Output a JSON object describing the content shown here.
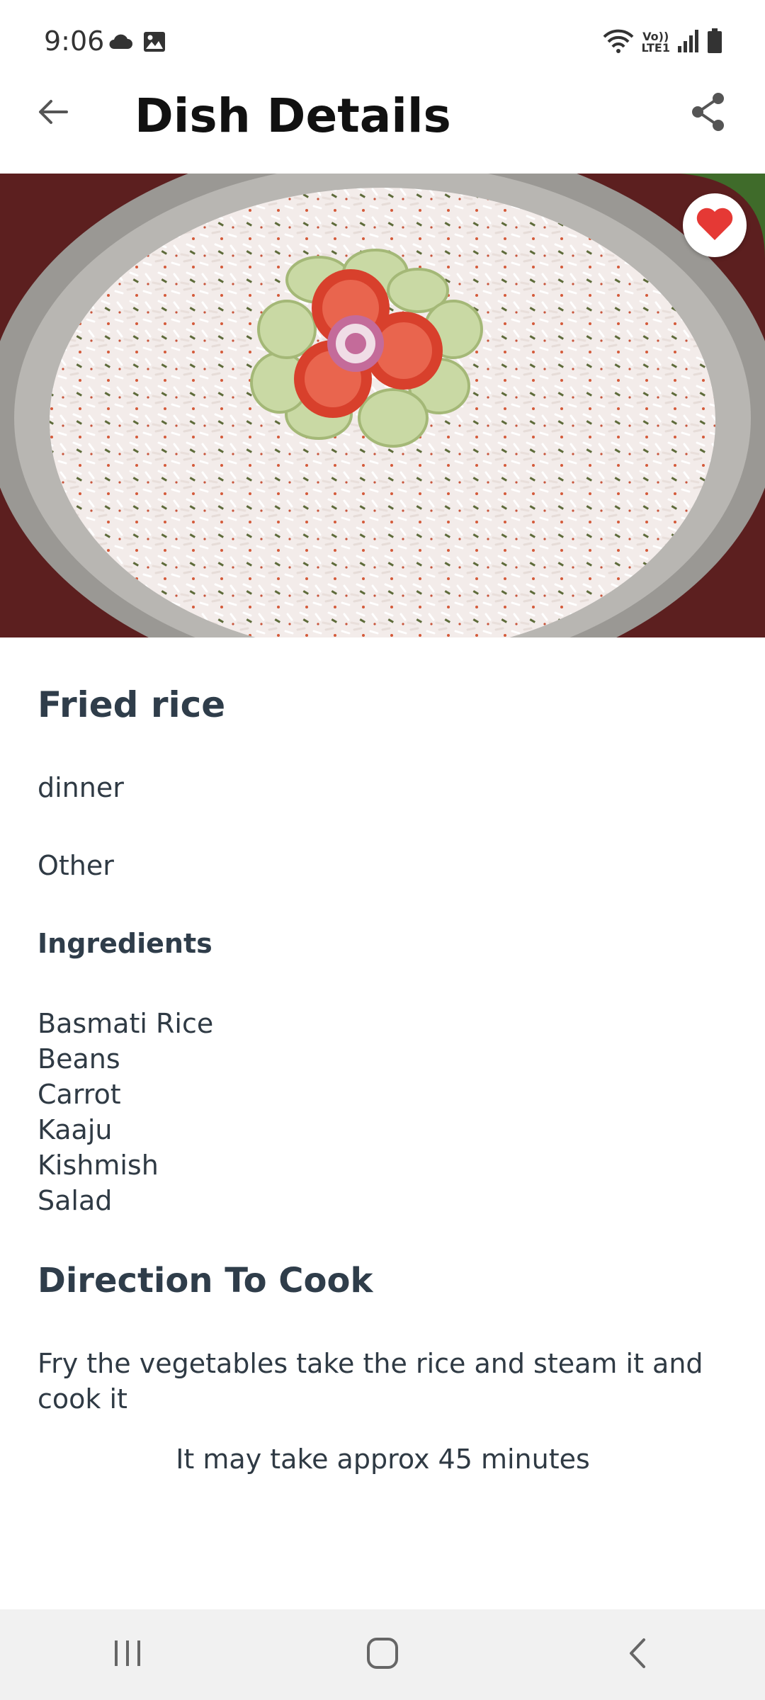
{
  "status_bar": {
    "time": "9:06",
    "lte_top": "Vo))",
    "lte_bottom": "LTE1",
    "icons": [
      "cloud-icon",
      "image-icon",
      "wifi-icon",
      "signal-icon",
      "battery-icon"
    ]
  },
  "app_bar": {
    "title": "Dish Details",
    "back_icon": "arrow-left-icon",
    "share_icon": "share-icon"
  },
  "hero": {
    "favorite_icon": "heart-icon",
    "favorite_color": "#e53935"
  },
  "dish": {
    "name": "Fried rice",
    "meal_type": "dinner",
    "category": "Other",
    "ingredients_heading": "Ingredients",
    "ingredients": [
      "Basmati Rice",
      "Beans",
      "Carrot",
      "Kaaju",
      "Kishmish",
      "Salad"
    ],
    "direction_heading": "Direction To Cook",
    "direction": "Fry the vegetables take the rice and steam it and cook it",
    "time_text": "It may take approx 45 minutes"
  },
  "nav_bar": {
    "icons": [
      "recent-apps-icon",
      "home-icon",
      "back-icon"
    ]
  }
}
